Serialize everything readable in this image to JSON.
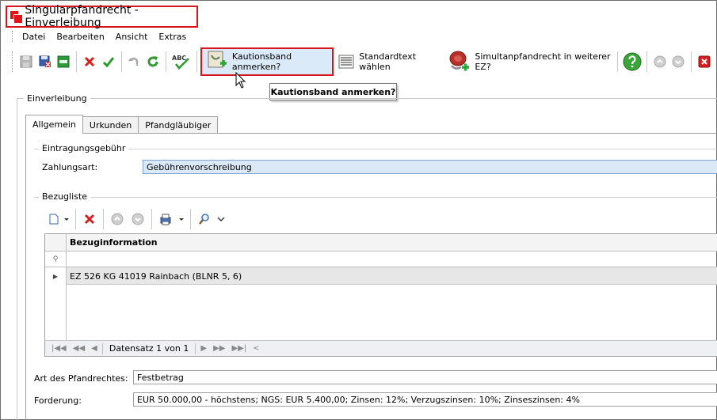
{
  "window": {
    "title": "Singularpfandrecht - Einverleibung"
  },
  "menu": {
    "items": [
      "Datei",
      "Bearbeiten",
      "Ansicht",
      "Extras"
    ]
  },
  "toolbar": {
    "kaution_label": "Kautionsband anmerken?",
    "standardtext_label": "Standardtext wählen",
    "simultan_label": "Simultanpfandrecht in weiterer EZ?",
    "abc_glyph": "ABC"
  },
  "tooltip": {
    "text": "Kautionsband anmerken?"
  },
  "group": {
    "title": "Einverleibung"
  },
  "tabs": [
    {
      "label": "Allgemein"
    },
    {
      "label": "Urkunden"
    },
    {
      "label": "Pfandgläubiger"
    }
  ],
  "fee": {
    "legend": "Eintragungsgebühr",
    "zahlungsart_label": "Zahlungsart:",
    "zahlungsart_value": "Gebührenvorschreibung"
  },
  "references": {
    "legend": "Bezugliste",
    "column": "Bezuginformation",
    "rows": [
      {
        "value": "EZ 526 KG 41019 Rainbach (BLNR 5, 6)"
      }
    ],
    "navigator": "Datensatz 1 von 1"
  },
  "lien": {
    "art_label": "Art des Pfandrechtes:",
    "art_value": "Festbetrag",
    "forderung_label": "Forderung:",
    "forderung_value": "EUR 50.000,00 - höchstens; NGS: EUR 5.400,00; Zinsen: 12%; Verzugszinsen: 10%; Zinseszinsen: 4%"
  },
  "colors": {
    "highlight": "#d8141c",
    "selection": "#dbe8f5"
  }
}
